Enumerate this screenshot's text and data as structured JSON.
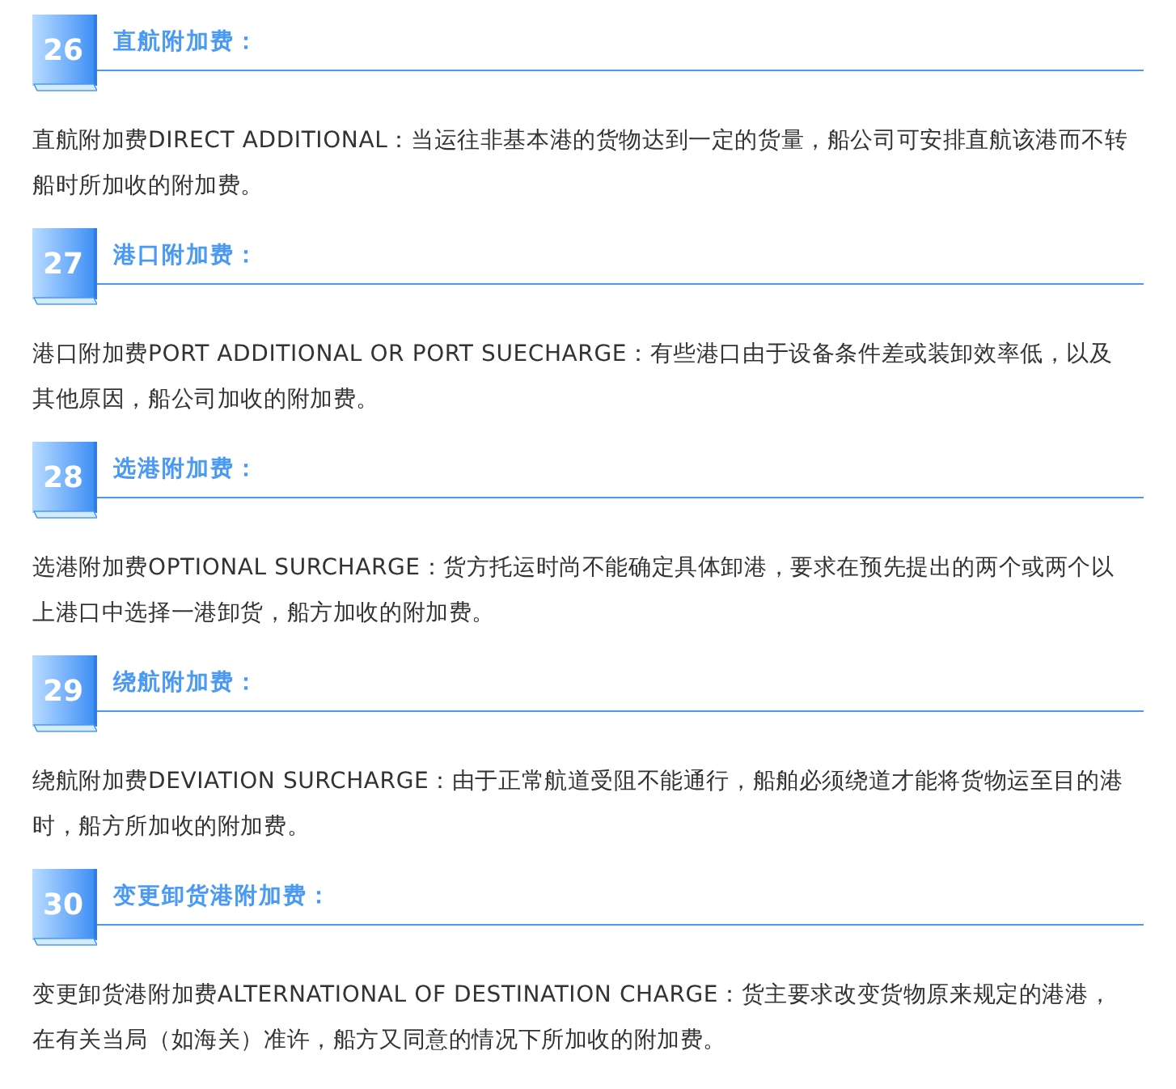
{
  "sections": [
    {
      "number": "26",
      "title": "直航附加费：",
      "body": "直航附加费DIRECT ADDITIONAL：当运往非基本港的货物达到一定的货量，船公司可安排直航该港而不转船时所加收的附加费。"
    },
    {
      "number": "27",
      "title": "港口附加费：",
      "body": "港口附加费PORT ADDITIONAL OR PORT SUECHARGE：有些港口由于设备条件差或装卸效率低，以及其他原因，船公司加收的附加费。"
    },
    {
      "number": "28",
      "title": "选港附加费：",
      "body": "选港附加费OPTIONAL SURCHARGE：货方托运时尚不能确定具体卸港，要求在预先提出的两个或两个以上港口中选择一港卸货，船方加收的附加费。"
    },
    {
      "number": "29",
      "title": "绕航附加费：",
      "body": "绕航附加费DEVIATION SURCHARGE：由于正常航道受阻不能通行，船舶必须绕道才能将货物运至目的港时，船方所加收的附加费。"
    },
    {
      "number": "30",
      "title": "变更卸货港附加费：",
      "body": "变更卸货港附加费ALTERNATIONAL OF DESTINATION CHARGE：货主要求改变货物原来规定的港港，在有关当局（如海关）准许，船方又同意的情况下所加收的附加费。"
    }
  ]
}
